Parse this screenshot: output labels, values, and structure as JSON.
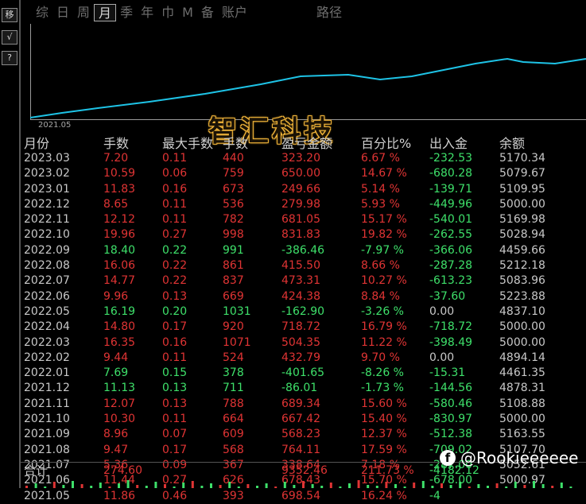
{
  "sidebar": {
    "buttons": [
      {
        "label": "移",
        "name": "move"
      },
      {
        "label": "√",
        "name": "check"
      },
      {
        "label": "?",
        "name": "help"
      }
    ]
  },
  "tabs": [
    {
      "label": "综",
      "active": false
    },
    {
      "label": "日",
      "active": false
    },
    {
      "label": "周",
      "active": false
    },
    {
      "label": "月",
      "active": true
    },
    {
      "label": "季",
      "active": false
    },
    {
      "label": "年",
      "active": false
    },
    {
      "label": "巾",
      "active": false
    },
    {
      "label": "M",
      "active": false
    },
    {
      "label": "备",
      "active": false
    },
    {
      "label": "账户",
      "active": false
    }
  ],
  "path_label": "路径",
  "chart": {
    "start_label": "2021.05",
    "line_color": "#1ec3e6",
    "balance_series": [
      5000.97,
      5107.7,
      5163.55,
      5000.0,
      5108.88,
      4878.31,
      4461.35,
      4894.14,
      5000.0,
      5000.0,
      4837.1,
      5223.88,
      5083.96,
      5212.18,
      4459.66,
      5028.94,
      5169.98,
      5000.0,
      5109.95,
      5079.67,
      5170.34
    ]
  },
  "watermark": "智汇科技",
  "table": {
    "headers": {
      "month": "月份",
      "qty": "手数",
      "max": "最大手数",
      "hand": "手数",
      "pnl": "盈亏金额",
      "pct": "百分比%",
      "flow": "出入金",
      "bal": "余额"
    },
    "rows": [
      {
        "month": "2023.03",
        "qty": "7.20",
        "max": "0.11",
        "hand": "440",
        "pnl": "323.20",
        "pct": "6.67 %",
        "flow": "-232.53",
        "bal": "5170.34",
        "c": "red"
      },
      {
        "month": "2023.02",
        "qty": "10.59",
        "max": "0.06",
        "hand": "759",
        "pnl": "650.00",
        "pct": "14.67 %",
        "flow": "-680.28",
        "bal": "5079.67",
        "c": "red"
      },
      {
        "month": "2023.01",
        "qty": "11.83",
        "max": "0.16",
        "hand": "673",
        "pnl": "249.66",
        "pct": "5.14 %",
        "flow": "-139.71",
        "bal": "5109.95",
        "c": "red"
      },
      {
        "month": "2022.12",
        "qty": "8.65",
        "max": "0.11",
        "hand": "536",
        "pnl": "279.98",
        "pct": "5.93 %",
        "flow": "-449.96",
        "bal": "5000.00",
        "c": "red"
      },
      {
        "month": "2022.11",
        "qty": "12.12",
        "max": "0.11",
        "hand": "782",
        "pnl": "681.05",
        "pct": "15.17 %",
        "flow": "-540.01",
        "bal": "5169.98",
        "c": "red"
      },
      {
        "month": "2022.10",
        "qty": "19.96",
        "max": "0.27",
        "hand": "998",
        "pnl": "831.83",
        "pct": "19.82 %",
        "flow": "-262.55",
        "bal": "5028.94",
        "c": "red"
      },
      {
        "month": "2022.09",
        "qty": "18.40",
        "max": "0.22",
        "hand": "991",
        "pnl": "-386.46",
        "pct": "-7.97 %",
        "flow": "-366.06",
        "bal": "4459.66",
        "c": "green"
      },
      {
        "month": "2022.08",
        "qty": "16.06",
        "max": "0.22",
        "hand": "861",
        "pnl": "415.50",
        "pct": "8.66 %",
        "flow": "-287.28",
        "bal": "5212.18",
        "c": "red"
      },
      {
        "month": "2022.07",
        "qty": "14.77",
        "max": "0.22",
        "hand": "837",
        "pnl": "473.31",
        "pct": "10.27 %",
        "flow": "-613.23",
        "bal": "5083.96",
        "c": "red"
      },
      {
        "month": "2022.06",
        "qty": "9.96",
        "max": "0.13",
        "hand": "669",
        "pnl": "424.38",
        "pct": "8.84 %",
        "flow": "-37.60",
        "bal": "5223.88",
        "c": "red"
      },
      {
        "month": "2022.05",
        "qty": "16.19",
        "max": "0.20",
        "hand": "1031",
        "pnl": "-162.90",
        "pct": "-3.26 %",
        "flow": "0.00",
        "bal": "4837.10",
        "c": "green"
      },
      {
        "month": "2022.04",
        "qty": "14.80",
        "max": "0.17",
        "hand": "920",
        "pnl": "718.72",
        "pct": "16.79 %",
        "flow": "-718.72",
        "bal": "5000.00",
        "c": "red"
      },
      {
        "month": "2022.03",
        "qty": "16.35",
        "max": "0.16",
        "hand": "1071",
        "pnl": "504.35",
        "pct": "11.22 %",
        "flow": "-398.49",
        "bal": "5000.00",
        "c": "red"
      },
      {
        "month": "2022.02",
        "qty": "9.44",
        "max": "0.11",
        "hand": "524",
        "pnl": "432.79",
        "pct": "9.70 %",
        "flow": "0.00",
        "bal": "4894.14",
        "c": "red"
      },
      {
        "month": "2022.01",
        "qty": "7.69",
        "max": "0.15",
        "hand": "378",
        "pnl": "-401.65",
        "pct": "-8.26 %",
        "flow": "-15.31",
        "bal": "4461.35",
        "c": "green"
      },
      {
        "month": "2021.12",
        "qty": "11.13",
        "max": "0.13",
        "hand": "711",
        "pnl": "-86.01",
        "pct": "-1.73 %",
        "flow": "-144.56",
        "bal": "4878.31",
        "c": "green"
      },
      {
        "month": "2021.11",
        "qty": "12.07",
        "max": "0.13",
        "hand": "788",
        "pnl": "689.34",
        "pct": "15.60 %",
        "flow": "-580.46",
        "bal": "5108.88",
        "c": "red"
      },
      {
        "month": "2021.10",
        "qty": "10.30",
        "max": "0.11",
        "hand": "664",
        "pnl": "667.42",
        "pct": "15.40 %",
        "flow": "-830.97",
        "bal": "5000.00",
        "c": "red"
      },
      {
        "month": "2021.09",
        "qty": "8.96",
        "max": "0.07",
        "hand": "609",
        "pnl": "568.23",
        "pct": "12.37 %",
        "flow": "-512.38",
        "bal": "5163.55",
        "c": "red"
      },
      {
        "month": "2021.08",
        "qty": "9.47",
        "max": "0.17",
        "hand": "568",
        "pnl": "764.11",
        "pct": "17.59 %",
        "flow": "-709.02",
        "bal": "5107.70",
        "c": "red"
      },
      {
        "month": "2021.07",
        "qty": "5.36",
        "max": "0.09",
        "hand": "367",
        "pnl": "338.64",
        "pct": "7.18 %",
        "flow": "-287.00",
        "bal": "5052.61",
        "c": "red"
      },
      {
        "month": "2021.06",
        "qty": "11.44",
        "max": "0.27",
        "hand": "626",
        "pnl": "678.43",
        "pct": "15.70 %",
        "flow": "-678.00",
        "bal": "5000.97",
        "c": "red"
      },
      {
        "month": "2021.05",
        "qty": "11.86",
        "max": "0.46",
        "hand": "393",
        "pnl": "698.54",
        "pct": "16.24 %",
        "flow": "-4",
        "bal": "",
        "c": "red"
      }
    ],
    "total": {
      "label": "合计",
      "qty": "274.60",
      "pnl": "9352.46",
      "pct": "211.73 %",
      "flow": "-4182.12"
    }
  },
  "badge": {
    "text": "@Rookieeeeee",
    "icon": "facebook-icon"
  },
  "colors": {
    "up": "#e03434",
    "down": "#3ee06a",
    "line": "#1ec3e6",
    "watermark": "#f0b43a"
  }
}
